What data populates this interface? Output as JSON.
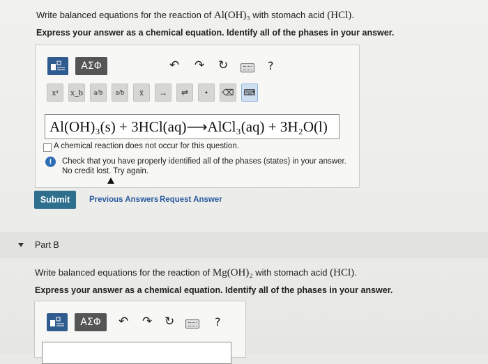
{
  "part_a": {
    "prompt_prefix": "Write balanced equations for the reaction of ",
    "prompt_formula": "Al(OH)₃",
    "prompt_mid": " with stomach acid ",
    "prompt_acid": "(HCl)",
    "prompt_end": ".",
    "instruction": "Express your answer as a chemical equation. Identify all of the phases in your answer.",
    "toolbar": {
      "greek_label": "ΑΣΦ",
      "help_label": "?",
      "keys": [
        "xᵃ",
        "x_b",
        "a/b",
        "a/b",
        "x̄",
        "→",
        "⇌",
        "•",
        "⌫",
        "⌨"
      ]
    },
    "answer": "Al(OH)₃(s) + 3HCl(aq)⟶AlCl₃(aq) + 3H₂O(l)",
    "no_reaction_label": "A chemical reaction does not occur for this question.",
    "feedback_line1": "Check that you have properly identified all of the phases (states) in your answer.",
    "feedback_line2": "No credit lost. Try again.",
    "submit_label": "Submit",
    "previous_label": "Previous Answers",
    "request_label": "Request Answer"
  },
  "part_b": {
    "title": "Part B",
    "prompt_prefix": "Write balanced equations for the reaction of ",
    "prompt_formula": "Mg(OH)₂",
    "prompt_mid": " with stomach acid ",
    "prompt_acid": "(HCl)",
    "prompt_end": ".",
    "instruction": "Express your answer as a chemical equation. Identify all of the phases in your answer.",
    "toolbar": {
      "greek_label": "ΑΣΦ",
      "help_label": "?"
    }
  },
  "colors": {
    "template_button": "#2f5b8e",
    "submit_button": "#2f6f8e",
    "link": "#2a5aa0",
    "info_icon": "#2d6db5"
  }
}
